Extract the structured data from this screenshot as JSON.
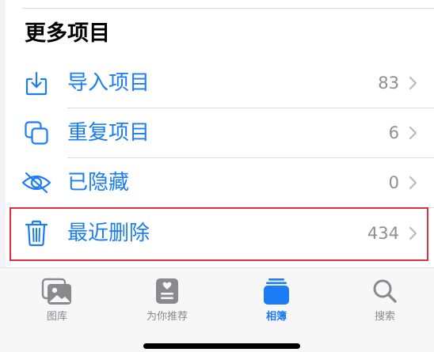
{
  "section": {
    "title": "更多项目"
  },
  "rows": [
    {
      "label": "导入项目",
      "count": "83",
      "icon": "import-tray-icon"
    },
    {
      "label": "重复项目",
      "count": "6",
      "icon": "duplicate-icon"
    },
    {
      "label": "已隐藏",
      "count": "0",
      "icon": "hidden-eye-icon"
    },
    {
      "label": "最近删除",
      "count": "434",
      "icon": "trash-icon"
    }
  ],
  "tabbar": {
    "tabs": [
      {
        "label": "图库",
        "icon": "photos-library-icon",
        "active": false
      },
      {
        "label": "为你推荐",
        "icon": "for-you-icon",
        "active": false
      },
      {
        "label": "相簿",
        "icon": "albums-icon",
        "active": true
      },
      {
        "label": "搜索",
        "icon": "search-icon",
        "active": false
      }
    ]
  },
  "colors": {
    "accent": "#1b7cf5",
    "secondary_text": "#8e8e93",
    "highlight_border": "#e0303a",
    "inactive_tab": "#8a8a8e"
  }
}
